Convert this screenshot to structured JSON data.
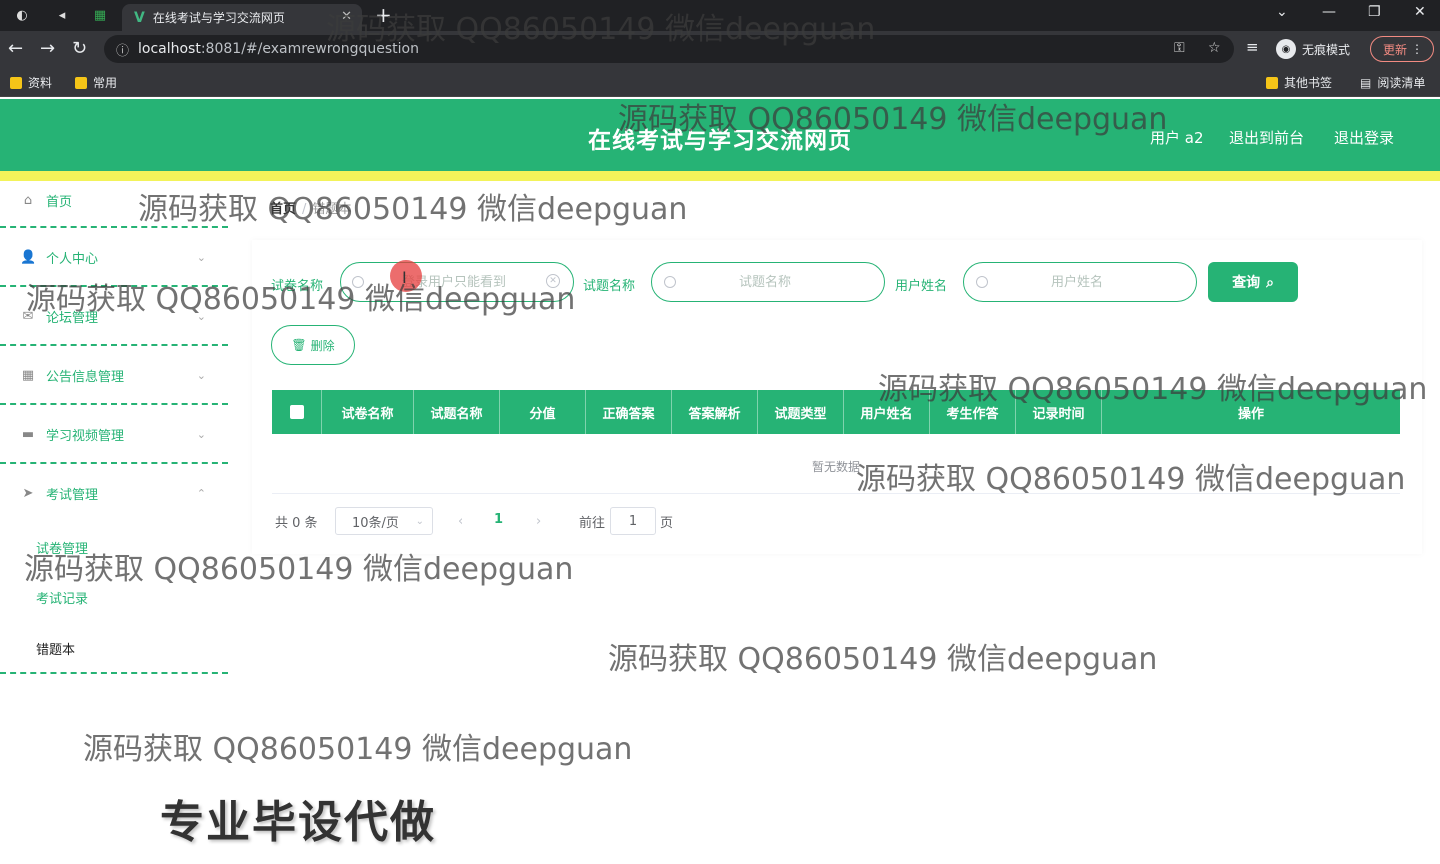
{
  "browser": {
    "tab_title": "在线考试与学习交流网页",
    "url_host": "localhost",
    "url_path": ":8081/#/examrewrongquestion",
    "incognito_label": "无痕模式",
    "update_label": "更新",
    "bookmarks": [
      "资料",
      "常用"
    ],
    "bookmarks_right": [
      "其他书签",
      "阅读清单"
    ]
  },
  "header": {
    "title": "在线考试与学习交流网页",
    "user_label": "用户 a2",
    "front_label": "退出到前台",
    "logout_label": "退出登录",
    "accent": "#26b375"
  },
  "sidebar": {
    "items": [
      {
        "label": "首页",
        "icon": "home-icon"
      },
      {
        "label": "个人中心",
        "icon": "user-icon"
      },
      {
        "label": "论坛管理",
        "icon": "mail-icon"
      },
      {
        "label": "公告信息管理",
        "icon": "grid-icon"
      },
      {
        "label": "学习视频管理",
        "icon": "briefcase-icon"
      },
      {
        "label": "考试管理",
        "icon": "send-icon"
      }
    ],
    "sub_items": [
      "试卷管理",
      "考试记录",
      "错题本"
    ]
  },
  "breadcrumb": {
    "home": "首页",
    "current": "错题本"
  },
  "filters": {
    "paper_label": "试卷名称",
    "paper_placeholder": "登录用户只能看到",
    "question_label": "试题名称",
    "question_placeholder": "试题名称",
    "user_label": "用户姓名",
    "user_placeholder": "用户姓名",
    "query_label": "查询"
  },
  "delete_label": "删除",
  "table": {
    "columns": [
      "试卷名称",
      "试题名称",
      "分值",
      "正确答案",
      "答案解析",
      "试题类型",
      "用户姓名",
      "考生作答",
      "记录时间",
      "操作"
    ],
    "empty_text": "暂无数据"
  },
  "pagination": {
    "total": "共 0 条",
    "page_size": "10条/页",
    "current": "1",
    "goto_label": "前往",
    "goto_value": "1",
    "page_suffix": "页"
  },
  "watermark": "源码获取 QQ86050149 微信deepguan",
  "promo": "专业毕设代做"
}
